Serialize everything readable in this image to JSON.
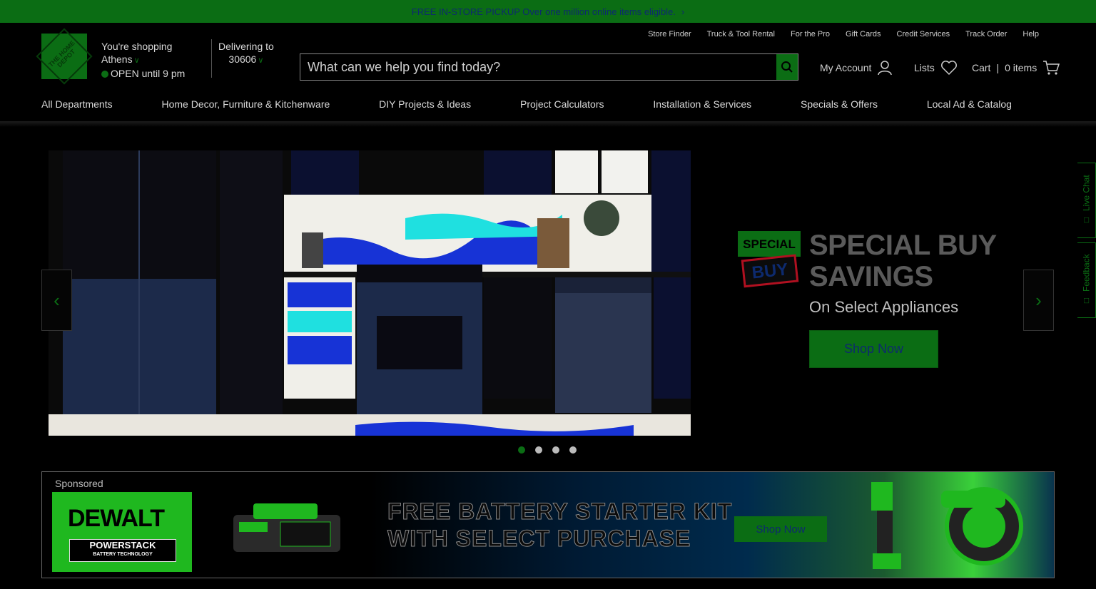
{
  "promo": {
    "text": "FREE IN-STORE PICKUP Over one million online items eligible.",
    "chevron": "›"
  },
  "logo": {
    "text": "THE HOME DEPOT"
  },
  "store": {
    "line1": "You're shopping",
    "line2": "Athens",
    "status": "OPEN",
    "hours": "until 9 pm"
  },
  "delivery": {
    "line1": "Delivering to",
    "zip": "30606"
  },
  "utility_links": [
    "Store Finder",
    "Truck & Tool Rental",
    "For the Pro",
    "Gift Cards",
    "Credit Services",
    "Track Order",
    "Help"
  ],
  "search": {
    "placeholder": "What can we help you find today?"
  },
  "account": {
    "my_account": "My Account",
    "lists": "Lists",
    "cart": "Cart",
    "cart_count": "0 items"
  },
  "nav": [
    "All Departments",
    "Home Decor, Furniture & Kitchenware",
    "DIY Projects & Ideas",
    "Project Calculators",
    "Installation & Services",
    "Specials & Offers",
    "Local Ad & Catalog"
  ],
  "hero": {
    "badge_top": "SPECIAL",
    "badge_bottom": "BUY",
    "title_line1": "SPECIAL BUY",
    "title_line2": "SAVINGS",
    "subtitle": "On Select Appliances",
    "button": "Shop Now",
    "slide_count": 4,
    "active_slide": 1
  },
  "side_tabs": {
    "live_chat": "Live Chat",
    "feedback": "Feedback"
  },
  "banner": {
    "sponsored": "Sponsored",
    "brand": "DEWALT",
    "sub_brand": "POWERSTACK",
    "sub_brand_tag": "BATTERY TECHNOLOGY",
    "headline_line1": "FREE BATTERY STARTER KIT",
    "headline_line2": "WITH SELECT PURCHASE",
    "button": "Shop Now"
  },
  "colors": {
    "brand_green": "#0b6d14",
    "link_navy": "#0d2a6e",
    "background": "#000000"
  }
}
